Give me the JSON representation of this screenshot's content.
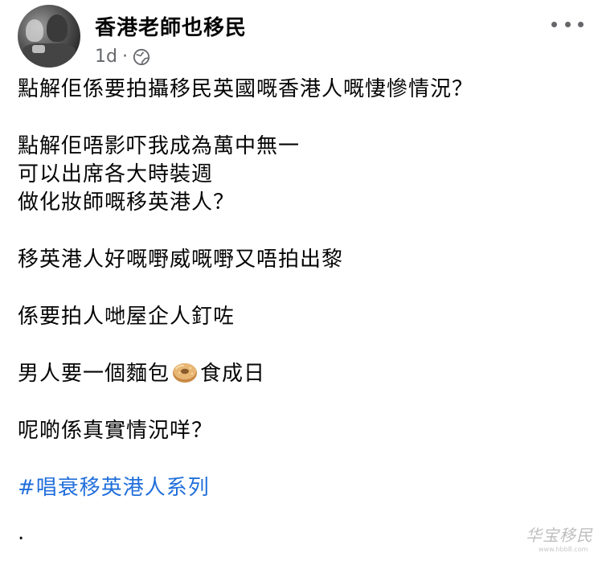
{
  "post": {
    "author": "香港老師也移民",
    "timestamp": "1d",
    "separator": "·",
    "privacy_icon": "globe-icon",
    "more_icon": "more-horizontal-icon",
    "lines": {
      "l1": "點解佢係要拍攝移民英國嘅香港人嘅悽慘情況？",
      "l2": "點解佢唔影吓我成為萬中無一",
      "l3": "可以出席各大時裝週",
      "l4": "做化妝師嘅移英港人？",
      "l5": "移英港人好嘅嘢威嘅嘢又唔拍出黎",
      "l6": "係要拍人哋屋企人釘咗",
      "l7a": "男人要一個麵包",
      "l7_emoji": "bagel-emoji",
      "l7b": "食成日",
      "l8": "呢啲係真實情況咩？",
      "hashtag": "#唱衰移英港人系列",
      "trailing": "."
    }
  },
  "watermark": {
    "text": "华宝移民",
    "sub": "www.hbb8.com"
  },
  "colors": {
    "text": "#050505",
    "meta": "#65676b",
    "link": "#216fdb",
    "background": "#ffffff"
  }
}
